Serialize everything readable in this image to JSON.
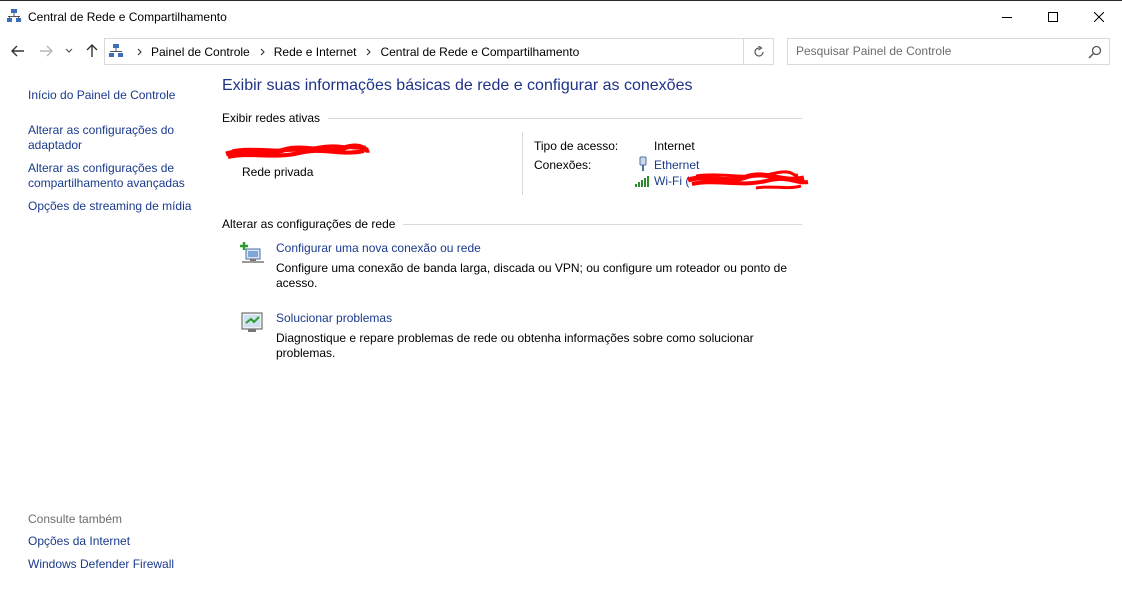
{
  "window": {
    "title": "Central de Rede e Compartilhamento"
  },
  "address": {
    "breadcrumbs": [
      "Painel de Controle",
      "Rede e Internet",
      "Central de Rede e Compartilhamento"
    ]
  },
  "search": {
    "placeholder": "Pesquisar Painel de Controle"
  },
  "sidebar": {
    "links": [
      "Início do Painel de Controle",
      "Alterar as configurações do adaptador",
      "Alterar as configurações de compartilhamento avançadas",
      "Opções de streaming de mídia"
    ],
    "see_also_header": "Consulte também",
    "see_also": [
      "Opções da Internet",
      "Windows Defender Firewall"
    ]
  },
  "main": {
    "title": "Exibir suas informações básicas de rede e configurar as conexões",
    "active_networks_header": "Exibir redes ativas",
    "network_type": "Rede privada",
    "access_type_label": "Tipo de acesso:",
    "access_type_value": "Internet",
    "connections_label": "Conexões:",
    "connections": [
      "Ethernet",
      "Wi-Fi ("
    ],
    "change_settings_header": "Alterar as configurações de rede",
    "tasks": [
      {
        "title": "Configurar uma nova conexão ou rede",
        "description": "Configure uma conexão de banda larga, discada ou VPN; ou configure um roteador ou ponto de acesso."
      },
      {
        "title": "Solucionar problemas",
        "description": "Diagnostique e repare problemas de rede ou obtenha informações sobre como solucionar problemas."
      }
    ]
  },
  "colors": {
    "link": "#1a3a8c",
    "title": "#1e3287",
    "redaction": "#ff0000"
  }
}
